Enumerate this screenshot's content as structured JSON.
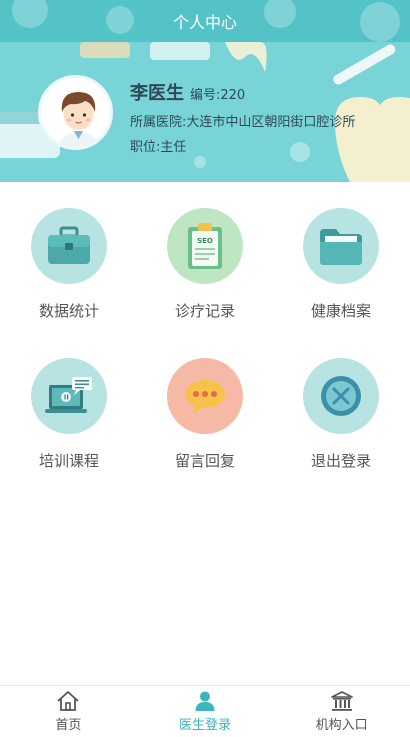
{
  "header": {
    "title": "个人中心"
  },
  "profile": {
    "name": "李医生",
    "number_label": "编号:220",
    "hospital": "所属医院:大连市中山区朝阳街口腔诊所",
    "position": "职位:主任"
  },
  "grid": [
    {
      "label": "数据统计",
      "icon": "briefcase-icon",
      "color": "#b8e3e3"
    },
    {
      "label": "诊疗记录",
      "icon": "clipboard-icon",
      "color": "#bfe6c2"
    },
    {
      "label": "健康档案",
      "icon": "folder-icon",
      "color": "#b8e3e3"
    },
    {
      "label": "培训课程",
      "icon": "laptop-icon",
      "color": "#b8e3e3"
    },
    {
      "label": "留言回复",
      "icon": "chat-bubble-icon",
      "color": "#f6b9a5"
    },
    {
      "label": "退出登录",
      "icon": "exit-icon",
      "color": "#b8e3e3"
    }
  ],
  "tabbar": [
    {
      "label": "首页",
      "icon": "home-icon",
      "active": false
    },
    {
      "label": "医生登录",
      "icon": "person-icon",
      "active": true
    },
    {
      "label": "机构入口",
      "icon": "institution-icon",
      "active": false
    }
  ],
  "colors": {
    "accent": "#3bb6bd",
    "header": "#54c3c8",
    "banner": "#78d3d6"
  }
}
